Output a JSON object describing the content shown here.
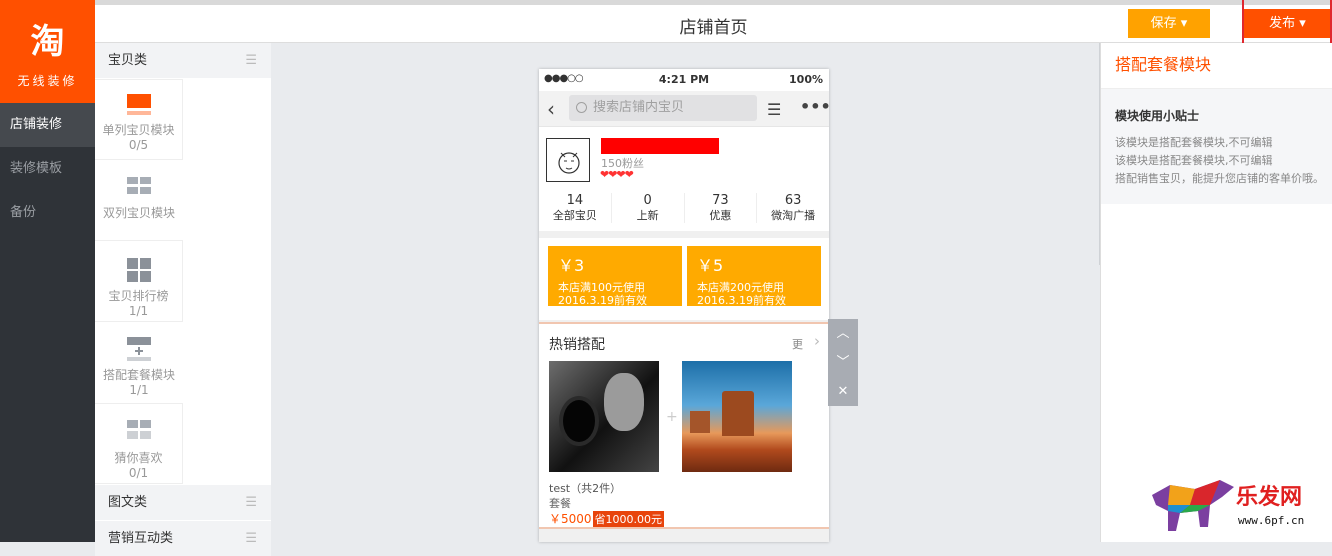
{
  "app": {
    "logo_glyph": "淘",
    "logo_sub": "无线装修",
    "nav": [
      {
        "label": "店铺装修",
        "active": true
      },
      {
        "label": "装修模板",
        "active": false
      },
      {
        "label": "备份",
        "active": false
      }
    ]
  },
  "topbar": {
    "title": "店铺首页",
    "save_label": "保存 ▾",
    "publish_label": "发布 ▾"
  },
  "modules": {
    "cat1": "宝贝类",
    "items": [
      {
        "label": "单列宝贝模块",
        "count": "0/5"
      },
      {
        "label": "双列宝贝模块",
        "count": ""
      },
      {
        "label": "宝贝排行榜",
        "count": "1/1"
      },
      {
        "label": "搭配套餐模块",
        "count": "1/1"
      },
      {
        "label": "猜你喜欢",
        "count": "0/1"
      }
    ],
    "cat2": "图文类",
    "cat3": "营销互动类"
  },
  "phone": {
    "status": {
      "dots": "●●●○○",
      "time": "4:21 PM",
      "battery": "100%"
    },
    "search_placeholder": "搜索店铺内宝贝",
    "shop": {
      "fans": "150粉丝",
      "hearts": "❤❤❤❤",
      "stats": [
        {
          "num": "14",
          "label": "全部宝贝"
        },
        {
          "num": "0",
          "label": "上新"
        },
        {
          "num": "73",
          "label": "优惠"
        },
        {
          "num": "63",
          "label": "微淘广播"
        }
      ]
    },
    "coupons": [
      {
        "amount": "￥3",
        "desc1": "本店满100元使用",
        "desc2": "2016.3.19前有效"
      },
      {
        "amount": "￥5",
        "desc1": "本店满200元使用",
        "desc2": "2016.3.19前有效"
      }
    ],
    "hot": {
      "title": "热销搭配",
      "more": "更",
      "chevron": "›",
      "plus": "+",
      "product_title": "test（共2件）",
      "product_sub": "套餐",
      "price": "￥5000",
      "save": "省1000.00元"
    }
  },
  "tools": {
    "up": "︿",
    "down": "﹀",
    "close": "✕"
  },
  "right_panel": {
    "title": "搭配套餐模块",
    "tip_title": "模块使用小贴士",
    "tips": [
      "该模块是搭配套餐模块,不可编辑",
      "该模块是搭配套餐模块,不可编辑",
      "搭配销售宝贝，能提升您店铺的客单价哦。"
    ]
  },
  "watermark": {
    "text": "乐发网",
    "url": "www.6pf.cn"
  },
  "colors": {
    "brand": "#ff5000",
    "save": "#ffa200",
    "coupon": "#ffaa00",
    "nav_bg": "#2f3338"
  }
}
